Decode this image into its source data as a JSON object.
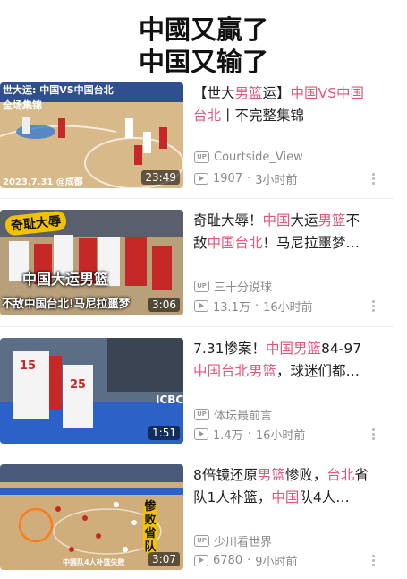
{
  "headline": {
    "line1": "中國又贏了",
    "line2": "中国又输了"
  },
  "videos": [
    {
      "title_parts": [
        {
          "text": "【世大",
          "hl": false
        },
        {
          "text": "男篮",
          "hl": true
        },
        {
          "text": "运】",
          "hl": false
        },
        {
          "text": "中国VS中国台北",
          "hl": true
        },
        {
          "text": "丨不完整集锦",
          "hl": false
        }
      ],
      "author": "Courtside_View",
      "views": "1907",
      "age": "3小时前",
      "duration": "23:49",
      "overlay_top": "世大运: 中国VS中国台北",
      "overlay_sub": "全场集锦",
      "overlay_date": "2023.7.31 @成都"
    },
    {
      "title_parts": [
        {
          "text": "奇耻大辱！",
          "hl": false
        },
        {
          "text": "中国",
          "hl": true
        },
        {
          "text": "大运",
          "hl": false
        },
        {
          "text": "男篮",
          "hl": true
        },
        {
          "text": "不敌",
          "hl": false
        },
        {
          "text": "中国台北",
          "hl": true
        },
        {
          "text": "！马尼拉噩梦…",
          "hl": false
        }
      ],
      "author": "三十分说球",
      "views": "13.1万",
      "age": "16小时前",
      "duration": "3:06",
      "overlay_badge": "奇耻大辱",
      "overlay_mid": "中国大运男篮",
      "overlay_bottom": "不敌中国台北!马尼拉噩梦"
    },
    {
      "title_parts": [
        {
          "text": "7.31惨案！",
          "hl": false
        },
        {
          "text": "中国男篮",
          "hl": true
        },
        {
          "text": "84-97",
          "hl": false
        },
        {
          "text": "中国台北男篮",
          "hl": true
        },
        {
          "text": "，球迷们都…",
          "hl": false
        }
      ],
      "author": "体坛最前言",
      "views": "1.4万",
      "age": "16小时前",
      "duration": "1:51",
      "overlay_jersey1": "15",
      "overlay_jersey2": "25",
      "overlay_sign": "ICBC"
    },
    {
      "title_parts": [
        {
          "text": "8倍镜还原",
          "hl": false
        },
        {
          "text": "男篮",
          "hl": true
        },
        {
          "text": "惨败，",
          "hl": false
        },
        {
          "text": "台北",
          "hl": true
        },
        {
          "text": "省队1人补篮，",
          "hl": false
        },
        {
          "text": "中国",
          "hl": true
        },
        {
          "text": "队4人…",
          "hl": false
        }
      ],
      "author": "少川看世界",
      "views": "6780",
      "age": "9小时前",
      "duration": "3:07",
      "overlay_side": "惨败省队",
      "overlay_caption": "中国队4人补篮失败"
    }
  ],
  "colors": {
    "highlight": "#e5567a",
    "meta": "#8a8a8a"
  },
  "icons": {
    "uploader": "up-icon",
    "views": "play-icon",
    "more": "more-vertical-icon"
  }
}
